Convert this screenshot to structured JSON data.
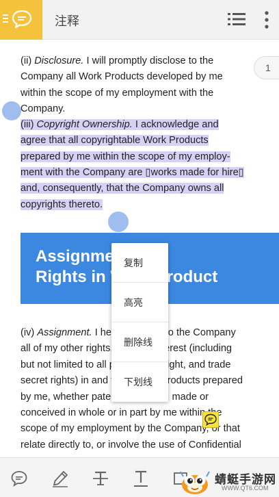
{
  "header": {
    "title": "注释"
  },
  "page_indicator": "1",
  "document": {
    "top_lines": [
      {
        "segments": [
          {
            "t": "(ii) ",
            "i": false
          },
          {
            "t": "Disclosure.",
            "i": true
          },
          {
            "t": " I will promptly disclose to the",
            "i": false
          }
        ],
        "hl": false
      },
      {
        "segments": [
          {
            "t": "Company all Work Products developed by me",
            "i": false
          }
        ],
        "hl": false
      },
      {
        "segments": [
          {
            "t": "within the scope of my employment with the",
            "i": false
          }
        ],
        "hl": false
      },
      {
        "segments": [
          {
            "t": "Company.",
            "i": false
          }
        ],
        "hl": false
      },
      {
        "segments": [
          {
            "t": "(iii) ",
            "i": false
          },
          {
            "t": "Copyright Ownership.",
            "i": true
          },
          {
            "t": " I acknowledge and",
            "i": false
          }
        ],
        "hl": true
      },
      {
        "segments": [
          {
            "t": "agree that all copyrightable Work Products",
            "i": false
          }
        ],
        "hl": true
      },
      {
        "segments": [
          {
            "t": "prepared by me within the scope of my employ-",
            "i": false
          }
        ],
        "hl": true
      },
      {
        "segments": [
          {
            "t": "ment with the Company are ▯works made for hire▯",
            "i": false
          }
        ],
        "hl": true
      },
      {
        "segments": [
          {
            "t": "and, consequently, that the Company owns all",
            "i": false
          }
        ],
        "hl": true
      },
      {
        "segments": [
          {
            "t": "copyrights thereto.",
            "i": false
          }
        ],
        "hl": true
      }
    ],
    "banner_lines": [
      "Assignment of",
      "Rights in Work Product"
    ],
    "bottom_lines": [
      {
        "segments": [
          {
            "t": "(iv) ",
            "i": false
          },
          {
            "t": "Assignment.",
            "i": true
          },
          {
            "t": " I hereby assign to the Company",
            "i": false
          }
        ]
      },
      {
        "segments": [
          {
            "t": "all of my other rights, title and interest (including",
            "i": false
          }
        ]
      },
      {
        "segments": [
          {
            "t": "but not limited to all patent, copyright, and trade",
            "i": false
          }
        ]
      },
      {
        "segments": [
          {
            "t": "secret rights) in and to all Work Products prepared",
            "i": false
          }
        ]
      },
      {
        "segments": [
          {
            "t": "by me, whether patentable or not, made or",
            "i": false
          }
        ]
      },
      {
        "segments": [
          {
            "t": "conceived in whole or in part by me within the",
            "i": false
          }
        ]
      },
      {
        "segments": [
          {
            "t": "scope of my employment by the Company, or that",
            "i": false
          }
        ]
      },
      {
        "segments": [
          {
            "t": "relate directly to, or involve the use of Confidential",
            "i": false
          }
        ]
      }
    ]
  },
  "context_menu": {
    "items": [
      {
        "label": "复制",
        "name": "menu-item-copy"
      },
      {
        "label": "高亮",
        "name": "menu-item-highlight"
      },
      {
        "label": "删除线",
        "name": "menu-item-strikethrough"
      },
      {
        "label": "下划线",
        "name": "menu-item-underline"
      }
    ]
  },
  "toolbar": {
    "tools": [
      {
        "name": "comment-tool",
        "icon": "comment-icon"
      },
      {
        "name": "pen-tool",
        "icon": "pen-icon"
      },
      {
        "name": "strikethrough-tool",
        "icon": "strikethrough-icon"
      },
      {
        "name": "underline-tool",
        "icon": "underline-icon"
      },
      {
        "name": "shape-tool",
        "icon": "shape-icon"
      }
    ]
  },
  "watermark": {
    "title": "蜻蜓手游网",
    "url": "WWW.QT6.COM"
  },
  "colors": {
    "accent_yellow": "#f5c33b",
    "highlight": "#d7d2f5",
    "banner_blue": "#3c87e0",
    "handle_blue": "#8fb1ec"
  }
}
